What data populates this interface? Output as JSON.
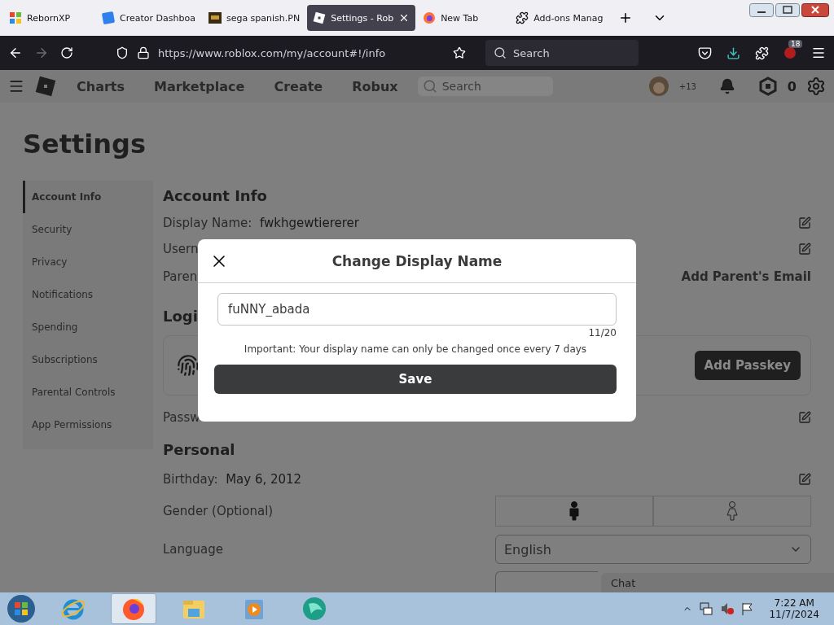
{
  "browser": {
    "tabs": [
      {
        "label": "RebornXP",
        "kind": "flag",
        "selected": false
      },
      {
        "label": "Creator Dashboa",
        "kind": "square",
        "selected": false
      },
      {
        "label": "sega spanish.PN",
        "kind": "image",
        "selected": false
      },
      {
        "label": "Settings - Rob",
        "kind": "roblox",
        "selected": true
      },
      {
        "label": "New Tab",
        "kind": "firefox",
        "selected": false
      },
      {
        "label": "Add-ons Manag",
        "kind": "puzzle",
        "selected": false
      }
    ],
    "address": "https://www.roblox.com/my/account#!/info",
    "search_placeholder": "Search",
    "extension_badge": "18"
  },
  "site_nav": {
    "items": [
      "Charts",
      "Marketplace",
      "Create",
      "Robux"
    ],
    "search_placeholder": "Search",
    "avatar_count": "+13",
    "robux": "0"
  },
  "settings": {
    "title": "Settings",
    "sidebar": [
      {
        "label": "Account Info",
        "selected": true
      },
      {
        "label": "Security",
        "selected": false
      },
      {
        "label": "Privacy",
        "selected": false
      },
      {
        "label": "Notifications",
        "selected": false
      },
      {
        "label": "Spending",
        "selected": false
      },
      {
        "label": "Subscriptions",
        "selected": false
      },
      {
        "label": "Parental Controls",
        "selected": false
      },
      {
        "label": "App Permissions",
        "selected": false
      }
    ],
    "account_info": {
      "title": "Account Info",
      "display_name_label": "Display Name:",
      "display_name": "fwkhgewtiererer",
      "username_label": "Usern",
      "parent_label": "Paren",
      "parent_action": "Add Parent's Email"
    },
    "login": {
      "title": "Logi",
      "passkey_button": "Add Passkey",
      "password_label": "Passw"
    },
    "personal": {
      "title": "Personal",
      "birthday_label": "Birthday:",
      "birthday": "May 6, 2012",
      "gender_label": "Gender (Optional)",
      "genders": [
        {
          "kind": "male",
          "selected": true
        },
        {
          "kind": "female",
          "selected": false
        }
      ],
      "language_label": "Language",
      "language": "English"
    }
  },
  "dialog": {
    "title": "Change Display Name",
    "value": "fuNNY_abada",
    "counter": "11/20",
    "note": "Important: Your display name can only be changed once every 7 days",
    "button": "Save"
  },
  "chat": {
    "label": "Chat"
  },
  "taskbar": {
    "apps": [
      {
        "kind": "ie",
        "selected": false
      },
      {
        "kind": "firefox",
        "selected": true
      },
      {
        "kind": "explorer",
        "selected": false
      },
      {
        "kind": "media",
        "selected": false
      },
      {
        "kind": "globe",
        "selected": false
      }
    ],
    "time": "7:22 AM",
    "date": "11/7/2024"
  }
}
